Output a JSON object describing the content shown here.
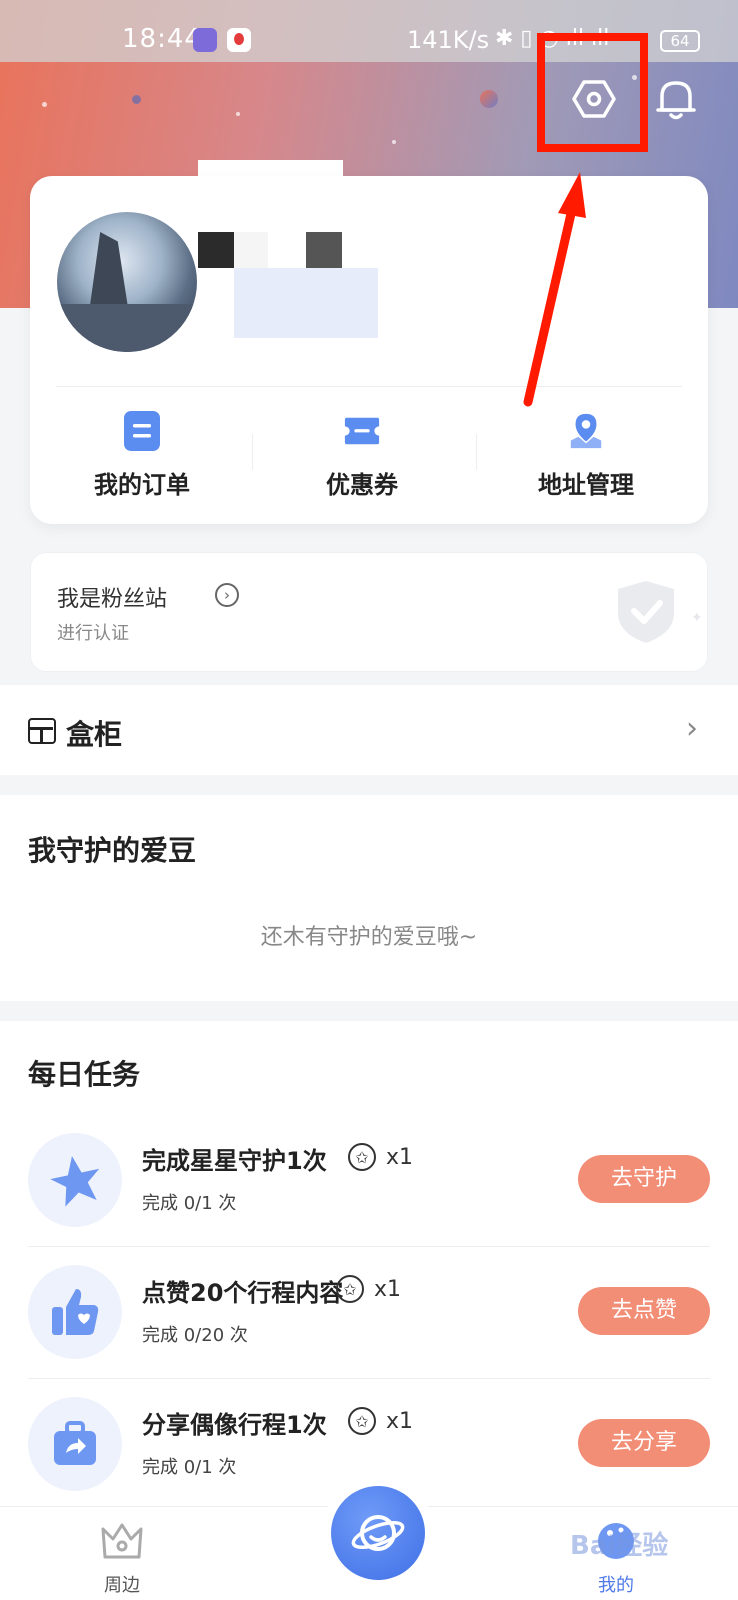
{
  "status_bar": {
    "time": "18:44",
    "network_speed": "141K/s",
    "battery": "64"
  },
  "header": {
    "settings_icon": "settings-hexagon-icon",
    "bell_icon": "bell-icon"
  },
  "profile": {
    "quick_actions": [
      {
        "label": "我的订单",
        "icon": "order-icon"
      },
      {
        "label": "优惠券",
        "icon": "coupon-icon"
      },
      {
        "label": "地址管理",
        "icon": "location-icon"
      }
    ]
  },
  "fan_station": {
    "title": "我是粉丝站",
    "subtitle": "进行认证"
  },
  "cabinet": {
    "label": "盒柜"
  },
  "guarded_idols": {
    "title": "我守护的爱豆",
    "empty_text": "还木有守护的爱豆哦~"
  },
  "daily_tasks": {
    "title": "每日任务",
    "items": [
      {
        "title": "完成星星守护1次",
        "reward": "x1",
        "progress": "完成 0/1 次",
        "button": "去守护",
        "icon": "star-icon"
      },
      {
        "title": "点赞20个行程内容",
        "reward": "x1",
        "progress": "完成 0/20 次",
        "button": "去点赞",
        "icon": "thumbs-up-icon"
      },
      {
        "title": "分享偶像行程1次",
        "reward": "x1",
        "progress": "完成 0/1 次",
        "button": "去分享",
        "icon": "share-suitcase-icon"
      }
    ]
  },
  "bottom_nav": {
    "items": [
      {
        "label": "周边",
        "icon": "crown-icon"
      },
      {
        "label": "",
        "icon": "planet-icon"
      },
      {
        "label": "我的",
        "icon": "profile-icon"
      }
    ]
  },
  "watermark": "Bai经验",
  "colors": {
    "accent_orange": "#f28d76",
    "icon_blue": "#5b8cf0",
    "highlight_red": "#ff1a00"
  }
}
